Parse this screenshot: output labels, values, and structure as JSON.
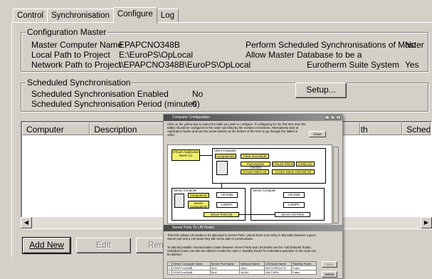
{
  "tabs": [
    "Control",
    "Synchronisation",
    "Configure",
    "Log"
  ],
  "active_tab": "Configure",
  "config_master": {
    "title": "Configuration Master",
    "rows": [
      {
        "label": "Master Computer Name",
        "value": "EPAPCNO348B"
      },
      {
        "label": "Local Path to Project",
        "value": "E:\\EuroPS\\OpLocal"
      },
      {
        "label": "Network Path to Project",
        "value": "\\\\EPAPCNO348B\\EuroPS\\OpLocal"
      }
    ],
    "right_rows": [
      {
        "label": "Perform Scheduled Synchronisations of Master",
        "value": "No"
      },
      {
        "label": "Allow Master Database to be a",
        "value": ""
      },
      {
        "label": "Eurotherm Suite System",
        "value": "Yes"
      }
    ]
  },
  "scheduled_sync": {
    "title": "Scheduled Synchronisation",
    "rows": [
      {
        "label": "Scheduled Synchronisation Enabled",
        "value": "No"
      },
      {
        "label": "Scheduled Synchronisation Period (minutes)",
        "value": "0"
      }
    ],
    "setup_button": "Setup..."
  },
  "list_columns": [
    "Computer",
    "Description",
    "th",
    "Schedu"
  ],
  "buttons": {
    "add_new": "Add New",
    "edit": "Edit",
    "remove": "Rem"
  },
  "overlay": {
    "window_title": "Computer Configuration",
    "instructions": "Click on the yellow box to select the table you wish to configure. If configuring for the first time then the tables should be configured in the order specified by the number in brackets. Alternatively start at Application Name and use the arrow buttons at the bottom of the form to go through the tables in order.",
    "close": "Close",
    "diagram": {
      "intouch_app": "InTouch Application Name (1)",
      "client_computer": "Client Computer",
      "computers_2": "Computers(2)",
      "client_security": "Client Security(9)",
      "factorysuite": "FactorySuite Client(6)",
      "intouch_io": "InTouch I/O(10)",
      "insql": "InSQL(11)",
      "access_name": "Access Name (4)",
      "access_override": "Access Name Override (5)",
      "server_computer_left": "Server Computer",
      "computers_left": "Computer(2)",
      "server_computers": "Server Computer(3)",
      "lin_data_left": "LIN Data",
      "lin_opc_left": "LINOPC",
      "server_computer_right": "Server Computer",
      "lin_data_right": "LIN Data",
      "lin_opc_right": "LINOPC",
      "server_ports": "Server Ports (6)",
      "server_lin_ports": "Server LIN Ports"
    },
    "sub_window_title": "Server Ports To LIN Nodes",
    "sub_text_1": "This form allows LIN Nodes to be allocated to Server Ports. Unless there is an entry in this table between a given Server port and a LIN Node they will not be able to communicate.",
    "sub_text_2": "To add all possible communication routes between Server Ports and LIN Nodes use the 'Add Defaults' button. Individual routes can then be edited to make the route a 'Standby Route' for redundant operation or the route can be deleted.",
    "table_headers": [
      "",
      "Server Computer Name",
      "Server Port Name",
      "Network Name",
      "LIN Node Name",
      "Standby Route"
    ],
    "table_rows": [
      [
        "1",
        "EPAPCno348B",
        "Sin1",
        "Alin1",
        "BATCHREACT0",
        "False"
      ],
      [
        "2",
        "EPAPCno348B",
        "Sin2",
        "ALIN2",
        "VAZTURN",
        "False"
      ]
    ],
    "sub_buttons": [
      "Save",
      "Delete"
    ]
  }
}
